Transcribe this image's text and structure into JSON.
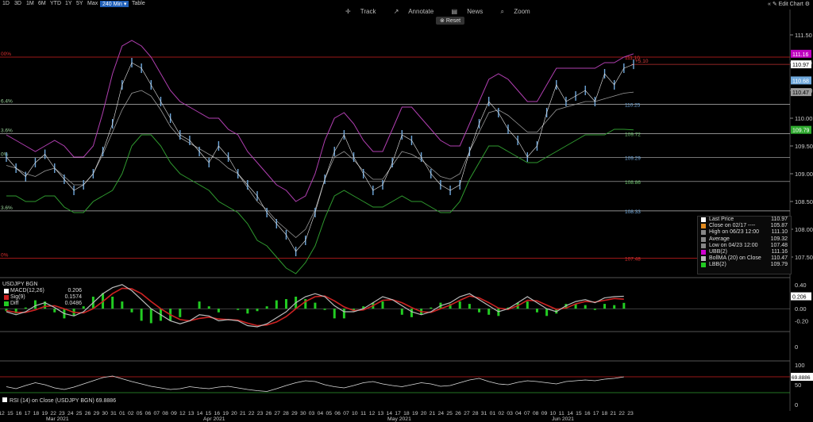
{
  "toolbar": {
    "ranges": [
      "1D",
      "3D",
      "1M",
      "6M",
      "YTD",
      "1Y",
      "5Y",
      "Max",
      "240 Min",
      "Table"
    ],
    "active_range": "240 Min",
    "track": "Track",
    "annotate": "Annotate",
    "news": "News",
    "zoom": "Zoom",
    "reset": "Reset",
    "edit_chart": "Edit Chart"
  },
  "colors": {
    "background": "#000000",
    "price": "#6fa8dc",
    "ubb": "#b13fb1",
    "lbb": "#2f9a2f",
    "bollma": "#9a9a9a",
    "fib_line": "#bbbbbb",
    "fib_top": "#d02020",
    "macd": "#bbbbbb",
    "signal": "#cc2222",
    "diff": "#22cc22",
    "rsi": "#dddddd",
    "rsi_band": "#cc2222"
  },
  "chart_data": {
    "type": "line",
    "symbol": "USDJPY BGN",
    "interval": "240 Min",
    "y_axis_ticks": [
      111.5,
      111.0,
      110.5,
      110.0,
      109.5,
      109.0,
      108.5,
      108.0,
      107.5
    ],
    "ylim": [
      107.2,
      111.7
    ],
    "fib_levels": [
      {
        "left": "00%",
        "right": "111.10",
        "value": 111.1,
        "top": true
      },
      {
        "left": "6.4%",
        "right": "110.25",
        "value": 110.25
      },
      {
        "left": "3.6%",
        "right": "109.72",
        "value": 109.72
      },
      {
        "left": "0%",
        "right": "109.29",
        "value": 109.29
      },
      {
        "left": "",
        "right": "108.86",
        "value": 108.86
      },
      {
        "left": "3.6%",
        "right": "108.33",
        "value": 108.33
      },
      {
        "left": "0%",
        "right": "107.48",
        "value": 107.48,
        "bottom": true
      }
    ],
    "last_price_line": {
      "value": 110.97,
      "delta_label": "+5.10"
    },
    "axis_badges": [
      {
        "label": "111.16",
        "value": 111.16,
        "color": "#c000c0"
      },
      {
        "label": "110.97",
        "value": 110.97,
        "color": "#ffffff"
      },
      {
        "label": "110.68",
        "value": 110.68,
        "color": "#6fa8dc"
      },
      {
        "label": "110.47",
        "value": 110.47,
        "color": "#9a9a9a"
      },
      {
        "label": "109.79",
        "value": 109.79,
        "color": "#2faa2f"
      }
    ],
    "price_series": [
      109.3,
      109.1,
      108.95,
      109.2,
      109.35,
      109.1,
      108.9,
      108.7,
      108.8,
      109.0,
      109.4,
      109.9,
      110.6,
      111.0,
      110.9,
      110.6,
      110.3,
      110.0,
      109.7,
      109.6,
      109.4,
      109.2,
      109.5,
      109.3,
      109.0,
      108.8,
      108.6,
      108.3,
      108.1,
      107.9,
      107.6,
      107.8,
      108.3,
      108.9,
      109.4,
      109.7,
      109.3,
      109.0,
      108.7,
      108.8,
      109.2,
      109.7,
      109.6,
      109.3,
      109.0,
      108.8,
      108.7,
      108.8,
      109.4,
      109.9,
      110.3,
      110.1,
      109.8,
      109.6,
      109.3,
      109.5,
      110.1,
      110.6,
      110.3,
      110.4,
      110.5,
      110.3,
      110.8,
      110.6,
      110.9,
      110.97
    ],
    "ubb_series": [
      109.7,
      109.6,
      109.5,
      109.4,
      109.5,
      109.6,
      109.5,
      109.3,
      109.3,
      109.5,
      110.1,
      110.8,
      111.3,
      111.4,
      111.3,
      111.1,
      110.8,
      110.5,
      110.3,
      110.2,
      110.1,
      110.0,
      110.0,
      109.8,
      109.7,
      109.4,
      109.2,
      109.0,
      108.8,
      108.7,
      108.5,
      108.6,
      109.0,
      109.6,
      110.0,
      110.1,
      109.9,
      109.6,
      109.4,
      109.4,
      109.8,
      110.2,
      110.2,
      110.0,
      109.8,
      109.6,
      109.5,
      109.5,
      109.9,
      110.3,
      110.7,
      110.8,
      110.7,
      110.5,
      110.3,
      110.3,
      110.6,
      110.9,
      110.9,
      110.9,
      110.9,
      110.9,
      111.0,
      111.0,
      111.1,
      111.16
    ],
    "lbb_series": [
      108.6,
      108.6,
      108.5,
      108.5,
      108.6,
      108.6,
      108.4,
      108.3,
      108.3,
      108.5,
      108.6,
      108.7,
      109.0,
      109.5,
      109.7,
      109.7,
      109.5,
      109.2,
      109.0,
      108.9,
      108.8,
      108.7,
      108.5,
      108.4,
      108.3,
      108.1,
      107.8,
      107.7,
      107.5,
      107.3,
      107.2,
      107.4,
      107.7,
      108.2,
      108.6,
      108.7,
      108.6,
      108.5,
      108.4,
      108.4,
      108.5,
      108.6,
      108.5,
      108.5,
      108.4,
      108.3,
      108.3,
      108.5,
      108.9,
      109.2,
      109.5,
      109.5,
      109.4,
      109.3,
      109.2,
      109.2,
      109.3,
      109.4,
      109.5,
      109.6,
      109.7,
      109.7,
      109.7,
      109.8,
      109.8,
      109.79
    ],
    "bollma_series": [
      109.15,
      109.1,
      109.0,
      108.95,
      109.05,
      109.1,
      108.95,
      108.8,
      108.8,
      109.0,
      109.35,
      109.75,
      110.15,
      110.45,
      110.5,
      110.4,
      110.15,
      109.85,
      109.65,
      109.55,
      109.45,
      109.35,
      109.25,
      109.1,
      109.0,
      108.75,
      108.5,
      108.35,
      108.15,
      108.0,
      107.85,
      108.0,
      108.35,
      108.9,
      109.3,
      109.4,
      109.25,
      109.05,
      108.9,
      108.9,
      109.15,
      109.4,
      109.35,
      109.25,
      109.1,
      108.95,
      108.9,
      109.0,
      109.4,
      109.75,
      110.1,
      110.15,
      110.05,
      109.9,
      109.75,
      109.75,
      109.95,
      110.15,
      110.2,
      110.25,
      110.3,
      110.3,
      110.35,
      110.4,
      110.45,
      110.47
    ],
    "x_tick_labels": [
      "12",
      "15",
      "16",
      "17",
      "18",
      "19",
      "22",
      "23",
      "24",
      "25",
      "26",
      "29",
      "30",
      "31",
      "01",
      "02",
      "05",
      "06",
      "07",
      "08",
      "09",
      "12",
      "13",
      "14",
      "15",
      "16",
      "19",
      "20",
      "21",
      "22",
      "23",
      "26",
      "27",
      "28",
      "29",
      "30",
      "03",
      "04",
      "05",
      "06",
      "07",
      "10",
      "11",
      "12",
      "13",
      "14",
      "17",
      "18",
      "19",
      "20",
      "21",
      "24",
      "25",
      "26",
      "27",
      "28",
      "31",
      "01",
      "02",
      "03",
      "04",
      "07",
      "08",
      "09",
      "10",
      "11",
      "14",
      "15",
      "16",
      "17",
      "18",
      "21",
      "22",
      "23"
    ],
    "month_labels": [
      "Mar 2021",
      "Apr 2021",
      "May 2021",
      "Jun 2021"
    ],
    "legend": [
      {
        "label": "Last Price",
        "value": "110.97",
        "color": "#ffffff"
      },
      {
        "label": "Close on 02/17 ----",
        "value": "105.87",
        "color": "#e08a1e"
      },
      {
        "label": "High on 06/23 12:00",
        "value": "111.10",
        "color": "#888888"
      },
      {
        "label": "Average",
        "value": "109.32",
        "color": "#888888"
      },
      {
        "label": "Low on 04/23 12:00",
        "value": "107.48",
        "color": "#888888"
      },
      {
        "label": "UBB(2)",
        "value": "111.16",
        "color": "#d000d0"
      },
      {
        "label": "BollMA (20)  on Close",
        "value": "110.47",
        "color": "#bbbbbb"
      },
      {
        "label": "LBB(2)",
        "value": "109.79",
        "color": "#22cc22"
      }
    ],
    "macd": {
      "title": "USDJPY BGN",
      "legend": [
        {
          "label": "MACD(12,26)",
          "value": "0.206",
          "color": "#ffffff"
        },
        {
          "label": "Sig(9)",
          "value": "0.1574",
          "color": "#cc2222"
        },
        {
          "label": "Diff",
          "value": "0.0486",
          "color": "#22cc22"
        }
      ],
      "y_ticks": [
        "0.40",
        "0.00",
        "-0.20"
      ],
      "badge": "0.206",
      "macd_series": [
        -0.05,
        -0.1,
        -0.05,
        0.05,
        0.1,
        0.02,
        -0.08,
        -0.12,
        -0.05,
        0.1,
        0.25,
        0.35,
        0.4,
        0.3,
        0.15,
        0.0,
        -0.1,
        -0.2,
        -0.25,
        -0.2,
        -0.1,
        -0.12,
        -0.2,
        -0.18,
        -0.2,
        -0.28,
        -0.3,
        -0.25,
        -0.15,
        -0.05,
        0.1,
        0.2,
        0.25,
        0.2,
        0.05,
        -0.05,
        -0.05,
        0.0,
        0.1,
        0.2,
        0.15,
        0.05,
        -0.05,
        -0.1,
        -0.05,
        0.05,
        0.1,
        0.2,
        0.25,
        0.15,
        0.05,
        -0.05,
        0.0,
        0.1,
        0.2,
        0.1,
        0.0,
        -0.05,
        0.05,
        0.12,
        0.15,
        0.1,
        0.18,
        0.2,
        0.206
      ],
      "signal_series": [
        -0.03,
        -0.06,
        -0.06,
        -0.02,
        0.04,
        0.05,
        0.0,
        -0.06,
        -0.07,
        0.0,
        0.12,
        0.25,
        0.34,
        0.33,
        0.25,
        0.12,
        0.0,
        -0.1,
        -0.18,
        -0.2,
        -0.16,
        -0.14,
        -0.17,
        -0.18,
        -0.19,
        -0.24,
        -0.28,
        -0.27,
        -0.22,
        -0.13,
        0.0,
        0.12,
        0.2,
        0.21,
        0.13,
        0.03,
        -0.03,
        -0.02,
        0.05,
        0.14,
        0.15,
        0.1,
        0.02,
        -0.05,
        -0.06,
        0.0,
        0.06,
        0.14,
        0.21,
        0.18,
        0.1,
        0.01,
        -0.01,
        0.05,
        0.14,
        0.13,
        0.06,
        -0.01,
        0.01,
        0.08,
        0.12,
        0.11,
        0.14,
        0.17,
        0.1574
      ]
    },
    "rsi": {
      "legend": "RSI (14)  on Close (USDJPY BGN) 69.8886",
      "y_ticks": [
        "100",
        "50",
        "0"
      ],
      "badge": "69.8886",
      "upper": 70,
      "lower": 30,
      "series": [
        45,
        40,
        48,
        55,
        50,
        42,
        38,
        44,
        52,
        60,
        68,
        72,
        65,
        58,
        52,
        46,
        42,
        38,
        40,
        45,
        42,
        40,
        44,
        46,
        42,
        38,
        35,
        33,
        40,
        48,
        55,
        60,
        58,
        50,
        45,
        42,
        48,
        55,
        58,
        52,
        48,
        45,
        50,
        55,
        52,
        46,
        48,
        55,
        62,
        66,
        58,
        52,
        50,
        56,
        60,
        58,
        55,
        52,
        58,
        60,
        62,
        60,
        64,
        66,
        69.8886
      ]
    }
  }
}
